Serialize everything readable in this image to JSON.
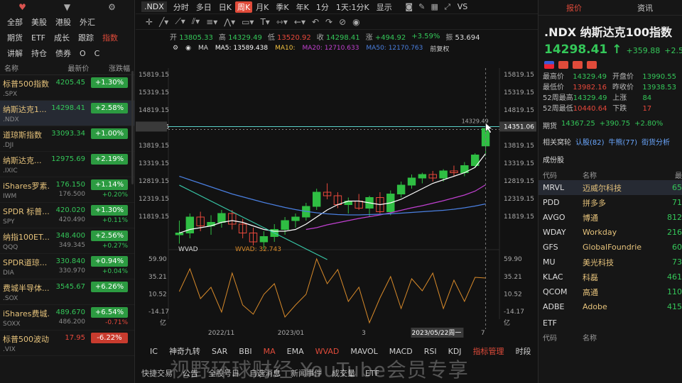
{
  "left_panel": {
    "tabs_row1": [
      "全部",
      "美股",
      "港股",
      "外汇"
    ],
    "tabs_row2": [
      "期货",
      "ETF",
      "成长",
      "跟踪",
      "指数"
    ],
    "tabs_row3": [
      "讲解",
      "持仓",
      "债券",
      "O",
      "C"
    ],
    "columns": [
      "名称",
      "最新价",
      "涨跌幅"
    ],
    "rows": [
      {
        "name": "标普500指数",
        "sym": ".SPX",
        "price": "4205.45",
        "price2": "",
        "chg": "+1.30%",
        "chg2": "",
        "dir": "up",
        "selected": false
      },
      {
        "name": "纳斯达克1...",
        "sym": ".NDX",
        "price": "14298.41",
        "price2": "",
        "chg": "+2.58%",
        "chg2": "",
        "dir": "up",
        "selected": true
      },
      {
        "name": "道琼斯指数",
        "sym": ".DJI",
        "price": "33093.34",
        "price2": "",
        "chg": "+1.00%",
        "chg2": "",
        "dir": "up",
        "selected": false
      },
      {
        "name": "纳斯达克...",
        "sym": ".IXIC",
        "price": "12975.69",
        "price2": "",
        "chg": "+2.19%",
        "chg2": "",
        "dir": "up",
        "selected": false
      },
      {
        "name": "iShares罗素...",
        "sym": "IWM",
        "price": "176.150",
        "price2": "176.500",
        "chg": "+1.14%",
        "chg2": "+0.20%",
        "dir": "up",
        "selected": false
      },
      {
        "name": "SPDR 标普...",
        "sym": "SPY",
        "price": "420.020",
        "price2": "420.490",
        "chg": "+1.30%",
        "chg2": "+0.11%",
        "dir": "up",
        "selected": false
      },
      {
        "name": "纳指100ET...",
        "sym": "QQQ",
        "price": "348.400",
        "price2": "349.345",
        "chg": "+2.56%",
        "chg2": "+0.27%",
        "dir": "up",
        "selected": false
      },
      {
        "name": "SPDR道琼...",
        "sym": "DIA",
        "price": "330.840",
        "price2": "330.970",
        "chg": "+0.94%",
        "chg2": "+0.04%",
        "dir": "up",
        "selected": false
      },
      {
        "name": "费城半导体...",
        "sym": ".SOX",
        "price": "3545.67",
        "price2": "",
        "chg": "+6.26%",
        "chg2": "",
        "dir": "up",
        "selected": false
      },
      {
        "name": "iShares费城...",
        "sym": "SOXX",
        "price": "489.670",
        "price2": "486.200",
        "chg": "+6.54%",
        "chg2": "-0.71%",
        "dir": "up",
        "selected": false
      },
      {
        "name": "标普500波动...",
        "sym": ".VIX",
        "price": "17.95",
        "price2": "",
        "chg": "-6.22%",
        "chg2": "",
        "dir": "dn",
        "selected": false
      }
    ]
  },
  "toolbar": {
    "symbol": ".NDX",
    "periods": [
      "分时",
      "多日",
      "日K",
      "周K",
      "月K",
      "季K",
      "年K",
      "1分",
      "1天:1分K",
      "显示"
    ],
    "active_period": "周K",
    "right_label": "VS"
  },
  "ohlc": {
    "open_label": "开",
    "open": "13805.33",
    "high_label": "高",
    "high": "14329.49",
    "low_label": "低",
    "low": "13520.92",
    "close_label": "收",
    "close": "14298.41",
    "chg_label": "涨",
    "chg": "+494.92",
    "pct": "+3.59%",
    "amp_label": "振",
    "amp": "53.694"
  },
  "ma_row": {
    "ma_label": "MA",
    "ma5": "MA5: 13589.438",
    "ma10": "MA10:",
    "ma20": "MA20: 12710.633",
    "ma50": "MA50: 12170.763",
    "adjust": "前复权"
  },
  "chart_axes": {
    "price_ticks": [
      "15819.15",
      "15319.15",
      "14819.15",
      "14351.06",
      "13819.15",
      "13319.15",
      "12819.15",
      "12319.15",
      "11819.15"
    ],
    "price_marker": "14351.06",
    "high_annotation": "14329.49",
    "ind_ticks": [
      "59.90",
      "35.21",
      "10.52",
      "-14.17"
    ],
    "ind_zero": "亿",
    "ind_label": "WVAD",
    "ind_value": "WVAD: 32.743",
    "x_ticks": [
      "2022/11",
      "2023/01",
      "3",
      "2023/05/22周一",
      "7"
    ]
  },
  "chart_data": [
    {
      "type": "candlestick",
      "series": [
        {
          "name": "K",
          "values": [
            {
              "o": 11300,
              "h": 11700,
              "l": 11050,
              "c": 11350
            },
            {
              "o": 11350,
              "h": 11900,
              "l": 11200,
              "c": 11800
            },
            {
              "o": 11800,
              "h": 11950,
              "l": 11400,
              "c": 11550
            },
            {
              "o": 11550,
              "h": 11850,
              "l": 11300,
              "c": 11650
            },
            {
              "o": 11650,
              "h": 12000,
              "l": 11500,
              "c": 11900
            },
            {
              "o": 11900,
              "h": 12000,
              "l": 11450,
              "c": 11600
            },
            {
              "o": 11600,
              "h": 11750,
              "l": 11200,
              "c": 11350
            },
            {
              "o": 11350,
              "h": 11500,
              "l": 11000,
              "c": 11100
            },
            {
              "o": 11100,
              "h": 11400,
              "l": 10900,
              "c": 11250
            },
            {
              "o": 11250,
              "h": 11600,
              "l": 11100,
              "c": 11450
            },
            {
              "o": 11450,
              "h": 11800,
              "l": 11300,
              "c": 11700
            },
            {
              "o": 11700,
              "h": 11900,
              "l": 11500,
              "c": 11800
            },
            {
              "o": 11800,
              "h": 12200,
              "l": 11700,
              "c": 12100
            },
            {
              "o": 12100,
              "h": 12600,
              "l": 12000,
              "c": 12500
            },
            {
              "o": 12500,
              "h": 12750,
              "l": 12300,
              "c": 12400
            },
            {
              "o": 12400,
              "h": 12500,
              "l": 12050,
              "c": 12150
            },
            {
              "o": 12150,
              "h": 12350,
              "l": 11900,
              "c": 12250
            },
            {
              "o": 12250,
              "h": 12450,
              "l": 12000,
              "c": 12050
            },
            {
              "o": 12050,
              "h": 12400,
              "l": 11800,
              "c": 12350
            },
            {
              "o": 12350,
              "h": 12500,
              "l": 11900,
              "c": 11950
            },
            {
              "o": 11950,
              "h": 12550,
              "l": 11850,
              "c": 12450
            },
            {
              "o": 12450,
              "h": 12800,
              "l": 12350,
              "c": 12700
            },
            {
              "o": 12700,
              "h": 13000,
              "l": 12600,
              "c": 12900
            },
            {
              "o": 12900,
              "h": 13050,
              "l": 12750,
              "c": 13000
            },
            {
              "o": 13000,
              "h": 13100,
              "l": 12800,
              "c": 12900
            },
            {
              "o": 12900,
              "h": 13150,
              "l": 12800,
              "c": 13100
            },
            {
              "o": 13100,
              "h": 13250,
              "l": 12950,
              "c": 13050
            },
            {
              "o": 13050,
              "h": 13350,
              "l": 12950,
              "c": 13250
            },
            {
              "o": 13250,
              "h": 13600,
              "l": 13200,
              "c": 13550
            },
            {
              "o": 13805,
              "h": 14329,
              "l": 13521,
              "c": 14298
            }
          ]
        },
        {
          "name": "MA5",
          "values": [
            11350,
            11450,
            11500,
            11550,
            11650,
            11700,
            11650,
            11550,
            11450,
            11400,
            11400,
            11450,
            11600,
            11800,
            12000,
            12150,
            12250,
            12250,
            12200,
            12150,
            12200,
            12300,
            12450,
            12600,
            12750,
            12850,
            12950,
            13050,
            13200,
            13589
          ]
        },
        {
          "name": "MA20",
          "values": [
            null,
            null,
            null,
            null,
            null,
            null,
            null,
            null,
            null,
            null,
            null,
            null,
            11450,
            11500,
            11580,
            11640,
            11700,
            11760,
            11810,
            11860,
            11920,
            11990,
            12060,
            12120,
            12190,
            12260,
            12340,
            12420,
            12530,
            12710
          ]
        },
        {
          "name": "MA50",
          "values": [
            12950,
            12850,
            12750,
            12650,
            12550,
            12450,
            12370,
            12290,
            12210,
            12140,
            12070,
            12010,
            11960,
            11920,
            11890,
            11870,
            11860,
            11860,
            11870,
            11880,
            11890,
            11910,
            11930,
            11950,
            11970,
            11990,
            12020,
            12060,
            12110,
            12170
          ]
        },
        {
          "name": "MA10",
          "values": [
            12700,
            12550,
            12400,
            12250,
            12100,
            11950,
            11800,
            11650,
            11500,
            11350,
            11200,
            11050,
            10900,
            10750,
            10600
          ]
        }
      ],
      "ylim": [
        11000,
        16000
      ]
    },
    {
      "type": "line",
      "series": [
        {
          "name": "WVAD",
          "values": [
            14,
            46,
            4,
            20,
            -15,
            40,
            -5,
            -18,
            10,
            25,
            -22,
            -5,
            10,
            60,
            25,
            45,
            0,
            20,
            -30,
            5,
            35,
            -10,
            32,
            15,
            40,
            -10,
            30,
            0,
            34,
            33
          ]
        }
      ],
      "ylim": [
        -25,
        65
      ]
    }
  ],
  "indicators": {
    "items": [
      "IC",
      "神奇九转",
      "SAR",
      "BBI",
      "MA",
      "EMA",
      "WVAD",
      "MAVOL",
      "MACD",
      "RSI",
      "KDJ",
      "指标管理",
      "时段"
    ],
    "active": [
      "MA",
      "WVAD",
      "指标管理"
    ]
  },
  "bottom_bar": {
    "items": [
      "快捷交易",
      "公告",
      "全股号日",
      "自选消息",
      "新闻事件",
      "成交量",
      "ETF"
    ],
    "watermark": "视野环球财经 YouTube会员专享"
  },
  "right_panel": {
    "tabs": [
      "报价",
      "资讯"
    ],
    "title": ".NDX  纳斯达克100指数",
    "price": "14298.41",
    "arrow": "↑",
    "chg": "+359.88",
    "pct": "+2.58%",
    "stats": [
      {
        "k": "最高价",
        "v": "14329.49",
        "k2": "开盘价",
        "v2": "13990.55"
      },
      {
        "k": "最低价",
        "v": "13982.16",
        "k2": "昨收价",
        "v2": "13938.53"
      },
      {
        "k": "52周最高",
        "v": "14329.49",
        "k2": "上涨",
        "v2": "84"
      },
      {
        "k": "52周最低",
        "v": "10440.64",
        "k2": "下跌",
        "v2": "17"
      }
    ],
    "futures_label": "期货",
    "futures_price": "14367.25",
    "futures_chg": "+390.75",
    "futures_pct": "+2.80%",
    "related_label": "相关窝轮",
    "related": [
      "认股(82)",
      "牛熊(77)",
      "街货分析"
    ],
    "components_label": "成份股",
    "comp_cols": [
      "代码",
      "名称",
      "最"
    ],
    "components": [
      {
        "code": "MRVL",
        "name": "迈威尔科技",
        "val": "65",
        "sel": true
      },
      {
        "code": "PDD",
        "name": "拼多多",
        "val": "71",
        "sel": false
      },
      {
        "code": "AVGO",
        "name": "博通",
        "val": "812",
        "sel": false
      },
      {
        "code": "WDAY",
        "name": "Workday",
        "val": "216",
        "sel": false
      },
      {
        "code": "GFS",
        "name": "GlobalFoundrie",
        "val": "60",
        "sel": false
      },
      {
        "code": "MU",
        "name": "美光科技",
        "val": "73",
        "sel": false
      },
      {
        "code": "KLAC",
        "name": "科磊",
        "val": "461",
        "sel": false
      },
      {
        "code": "QCOM",
        "name": "高通",
        "val": "110",
        "sel": false
      },
      {
        "code": "ADBE",
        "name": "Adobe",
        "val": "415",
        "sel": false
      }
    ],
    "etf_label": "ETF",
    "etf_cols": [
      "代码",
      "名称"
    ]
  }
}
